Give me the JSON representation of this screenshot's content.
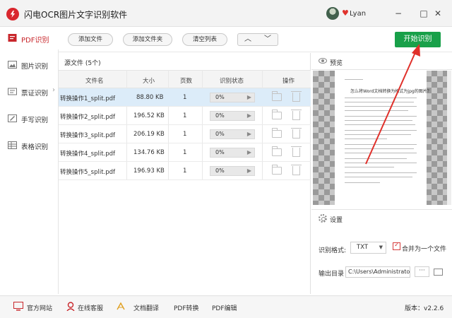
{
  "window": {
    "title": "闪电OCR图片文字识别软件",
    "username": "Lyan",
    "minimize_glyph": "−",
    "restore_glyph": "□",
    "close_glyph": "✕"
  },
  "sidebar": {
    "items": [
      {
        "label": "PDF识别",
        "icon": "pdf-icon",
        "active": true
      },
      {
        "label": "图片识别",
        "icon": "image-icon"
      },
      {
        "label": "票证识别",
        "icon": "ticket-icon",
        "chevron": "›"
      },
      {
        "label": "手写识别",
        "icon": "handwriting-icon"
      },
      {
        "label": "表格识别",
        "icon": "table-icon"
      }
    ]
  },
  "toolbar": {
    "add_file": "添加文件",
    "add_folder": "添加文件夹",
    "clear_list": "清空列表",
    "up_glyph": "︿",
    "down_glyph": "﹀",
    "start": "开始识别"
  },
  "files": {
    "source_label": "源文件 (5个)",
    "columns": [
      "文件名",
      "大小",
      "页数",
      "识别状态",
      "操作"
    ],
    "rows": [
      {
        "name": "转换操作1_split.pdf",
        "size": "88.80 KB",
        "pages": "1",
        "status": "0%"
      },
      {
        "name": "转换操作2_split.pdf",
        "size": "196.52 KB",
        "pages": "1",
        "status": "0%"
      },
      {
        "name": "转换操作3_split.pdf",
        "size": "206.19 KB",
        "pages": "1",
        "status": "0%"
      },
      {
        "name": "转换操作4_split.pdf",
        "size": "134.76 KB",
        "pages": "1",
        "status": "0%"
      },
      {
        "name": "转换操作5_split.pdf",
        "size": "196.93 KB",
        "pages": "1",
        "status": "0%"
      }
    ],
    "selected_row": 0
  },
  "preview": {
    "label": "预览",
    "doc_title": "怎么将Word文档转换为格式为jpg的图片？"
  },
  "settings": {
    "label": "设置",
    "format_label": "识别格式:",
    "format_value": "TXT",
    "merge_label": "合并为一个文件",
    "merge_checked": true,
    "output_label": "输出目录",
    "output_value": "C:\\Users\\Administrator\\",
    "more_glyph": "···"
  },
  "bottombar": {
    "website": "官方网站",
    "support": "在线客服",
    "translate": "文档翻译",
    "pdf_convert": "PDF转换",
    "pdf_edit": "PDF编辑",
    "version": "版本：v2.2.6"
  },
  "colors": {
    "accent_red": "#c8262b",
    "start_green": "#18a049",
    "selected_row": "#dcecf9",
    "annotation_arrow": "#e0302a"
  },
  "progress": [
    0,
    0,
    0,
    0,
    0
  ]
}
